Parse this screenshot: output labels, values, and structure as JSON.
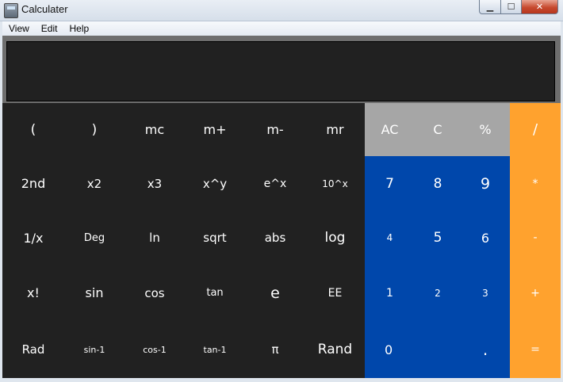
{
  "window": {
    "title": "Calculater",
    "min_label": "▁",
    "max_label": "☐",
    "close_label": "✕"
  },
  "menu": {
    "view": "View",
    "edit": "Edit",
    "help": "Help"
  },
  "display": {
    "value": ""
  },
  "colors": {
    "scientific": "#212121",
    "clear_row": "#a6a6a6",
    "digits": "#0047ab",
    "operators": "#ffa22e"
  },
  "keys": {
    "lparen": "(",
    "rparen": ")",
    "mc": "mc",
    "mplus": "m+",
    "mminus": "m-",
    "mr": "mr",
    "ac": "AC",
    "c": "C",
    "percent": "%",
    "divide": "/",
    "second": "2nd",
    "x2": "x2",
    "x3": "x3",
    "xpowy": "x^y",
    "epowx": "e^x",
    "tenpowx": "10^x",
    "d7": "7",
    "d8": "8",
    "d9": "9",
    "multiply": "*",
    "inverse": "1/x",
    "deg": "Deg",
    "ln": "ln",
    "sqrt": "sqrt",
    "abs": "abs",
    "log": "log",
    "d4": "4",
    "d5": "5",
    "d6": "6",
    "subtract": "-",
    "factorial": "x!",
    "sin": "sin",
    "cos": "cos",
    "tan": "tan",
    "e": "e",
    "ee": "EE",
    "d1": "1",
    "d2": "2",
    "d3": "3",
    "add": "+",
    "rad": "Rad",
    "asin": "sin-1",
    "acos": "cos-1",
    "atan": "tan-1",
    "pi": "π",
    "rand": "Rand",
    "d0": "0",
    "dot": ".",
    "equals": "="
  }
}
